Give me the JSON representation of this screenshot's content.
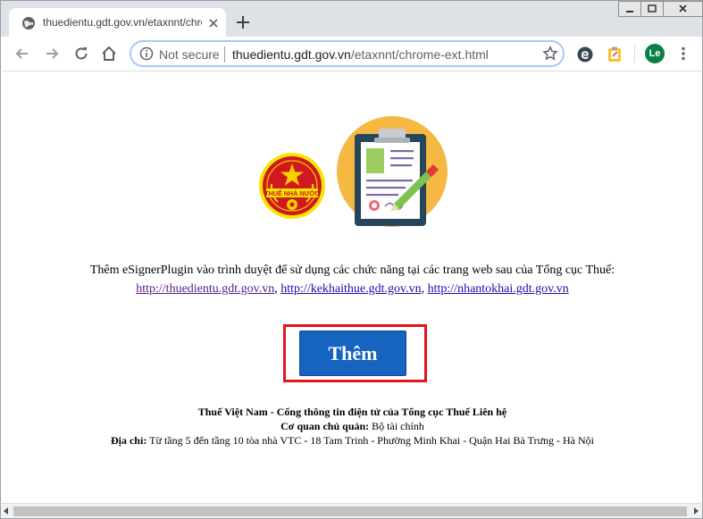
{
  "browser": {
    "tab_title": "thuedientu.gdt.gov.vn/etaxnnt/chrome-ext.html",
    "omnibox": {
      "security_label": "Not secure",
      "host": "thuedientu.gdt.gov.vn",
      "path": "/etaxnnt/chrome-ext.html"
    },
    "profile_initials": "Le",
    "colors": {
      "titlebar": "#dee1e6",
      "profile": "#0b8043"
    }
  },
  "page": {
    "emblem_text": "THUẾ NHÀ NƯỚC",
    "intro": "Thêm eSignerPlugin vào trình duyệt để sử dụng các chức năng tại các trang web sau của Tổng cục Thuế:",
    "links": [
      {
        "label": "http://thuedientu.gdt.gov.vn"
      },
      {
        "label": "http://kekhaithue.gdt.gov.vn"
      },
      {
        "label": "http://nhantokhai.gdt.gov.vn"
      }
    ],
    "link_separator": ", ",
    "add_button_label": "Thêm",
    "footer": {
      "line1": "Thuế Việt Nam - Cổng thông tin điện tử của Tổng cục Thuế Liên hệ",
      "agency_label": "Cơ quan chủ quản:",
      "agency_value": " Bộ tài chính",
      "address_label": "Địa chỉ:",
      "address_value": " Từ tầng 5 đến tầng 10 tòa nhà VTC - 18 Tam Trinh - Phường Minh Khai - Quận Hai Bà Trưng - Hà Nội"
    },
    "colors": {
      "button": "#1565c0",
      "highlight_border": "#e3151a",
      "link": "#1a0dab"
    }
  }
}
